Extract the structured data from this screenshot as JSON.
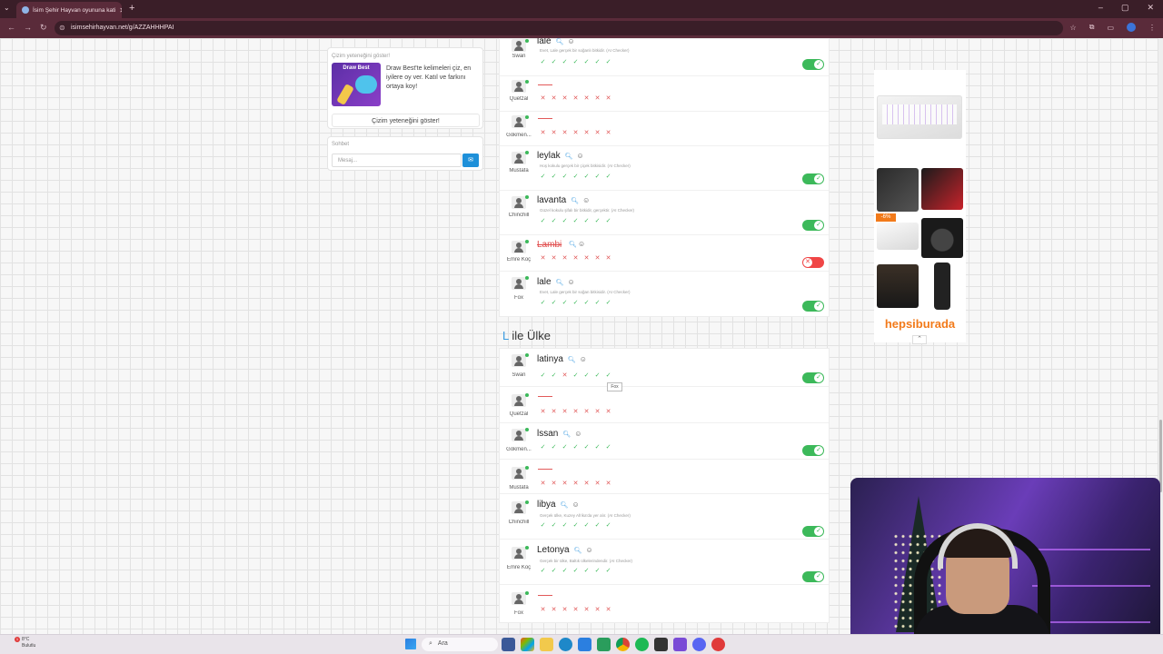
{
  "browser": {
    "tab_title": "İsim Şehir Hayvan oyununa kati",
    "url": "isimsehirhayvan.net/g/AZZAHHHPAI",
    "new_tab": "+",
    "tab_close": "✕"
  },
  "sidebar": {
    "draw_best": {
      "title": "Çizim yeteneğini göster!",
      "image_label": "Draw Best",
      "text": "Draw Best'te kelimeleri çiz, en iyilere oy ver. Katıl ve farkını ortaya koy!",
      "button": "Çizim yeteneğini göster!"
    },
    "chat": {
      "title": "Sohbet",
      "placeholder": "Mesaj...",
      "send_icon": "chat-bubble-icon"
    }
  },
  "category_a": {
    "rows": [
      {
        "player": "Swan",
        "answer": "lale",
        "note": "Evet, Lale gerçek bir soğanlı bitkidir. (AI Checker)",
        "votes": [
          "ok",
          "ok",
          "ok",
          "ok",
          "ok",
          "ok",
          "ok"
        ],
        "toggle": "on"
      },
      {
        "player": "Quetzal",
        "answer": "",
        "votes": [
          "no",
          "no",
          "no",
          "no",
          "no",
          "no",
          "no"
        ]
      },
      {
        "player": "Gökmen...",
        "answer": "",
        "votes": [
          "no",
          "no",
          "no",
          "no",
          "no",
          "no",
          "no"
        ]
      },
      {
        "player": "Mustafa",
        "answer": "leylak",
        "note": "Hoş kokulu gerçek bir çiçek bitkisidir. (AI Checker)",
        "votes": [
          "ok",
          "ok",
          "ok",
          "ok",
          "ok",
          "ok",
          "ok"
        ],
        "toggle": "on"
      },
      {
        "player": "Chinchill",
        "answer": "lavanta",
        "note": "Güzel kokulu şifalı bir bitkidir, gerçektir. (AI Checker)",
        "votes": [
          "ok",
          "ok",
          "ok",
          "ok",
          "ok",
          "ok",
          "ok"
        ],
        "toggle": "on"
      },
      {
        "player": "Emre Koç",
        "answer": "Lambi",
        "invalid": true,
        "votes": [
          "no",
          "no",
          "no",
          "no",
          "no",
          "no",
          "no"
        ],
        "toggle": "off"
      },
      {
        "player": "Fox",
        "answer": "lale",
        "note": "Evet, Lale gerçek bir soğan bitkisidir. (AI Checker)",
        "votes": [
          "ok",
          "ok",
          "ok",
          "ok",
          "ok",
          "ok",
          "ok"
        ],
        "toggle": "on"
      }
    ]
  },
  "category_b": {
    "letter": "L",
    "title": " ile Ülke",
    "tooltip": "Fox",
    "rows": [
      {
        "player": "Swan",
        "answer": "latinya",
        "votes": [
          "ok",
          "ok",
          "no",
          "ok",
          "ok",
          "ok",
          "ok"
        ],
        "toggle": "on"
      },
      {
        "player": "Quetzal",
        "answer": "",
        "votes": [
          "no",
          "no",
          "no",
          "no",
          "no",
          "no",
          "no"
        ]
      },
      {
        "player": "Gökmen...",
        "answer": "lssan",
        "votes": [
          "ok",
          "ok",
          "ok",
          "ok",
          "ok",
          "ok",
          "ok"
        ],
        "toggle": "on"
      },
      {
        "player": "Mustafa",
        "answer": "",
        "votes": [
          "no",
          "no",
          "no",
          "no",
          "no",
          "no",
          "no"
        ]
      },
      {
        "player": "Chinchill",
        "answer": "libya",
        "note": "Gerçek ülke, Kuzey Afrika'da yer alır. (AI Checker)",
        "votes": [
          "ok",
          "ok",
          "ok",
          "ok",
          "ok",
          "ok",
          "ok"
        ],
        "toggle": "on"
      },
      {
        "player": "Emre Koç",
        "answer": "Letonya",
        "note": "Gerçek bir ülke, Baltık ülkelerindendir. (AI Checker)",
        "votes": [
          "ok",
          "ok",
          "ok",
          "ok",
          "ok",
          "ok",
          "ok"
        ],
        "toggle": "on"
      },
      {
        "player": "Fox",
        "answer": "",
        "votes": [
          "no",
          "no",
          "no",
          "no",
          "no",
          "no",
          "no"
        ]
      }
    ]
  },
  "ad": {
    "discount": "-6%",
    "brand": "hepsiburada",
    "collapse": "⌃"
  },
  "taskbar": {
    "weather_temp": "8°C",
    "weather_desc": "Bulutlu",
    "weather_badge": "1",
    "search_label": "Ara"
  },
  "colors": {
    "accent_blue": "#3a9be0",
    "vote_ok": "#3cb95a",
    "vote_no": "#e25a5a",
    "brand_orange": "#f27a1a"
  }
}
